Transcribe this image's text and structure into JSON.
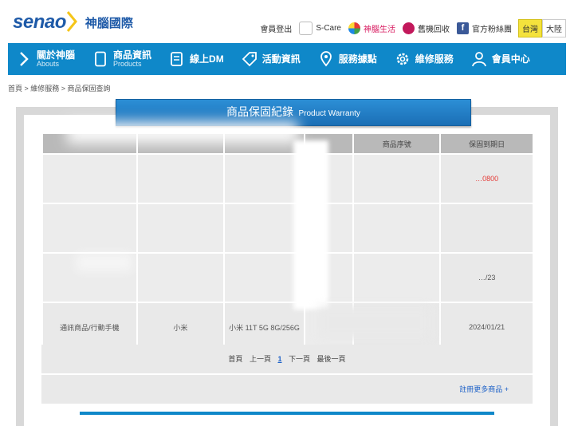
{
  "brand": {
    "word": "senao",
    "cn": "神腦國際"
  },
  "toplinks": {
    "logout": "會員登出",
    "scare": "S-Care",
    "life": "神腦生活",
    "recycle": "舊機回收",
    "fans": "官方粉絲團",
    "region_active": "台灣",
    "region_other": "大陸"
  },
  "nav": [
    {
      "label": "關於神腦",
      "sub": "Abouts"
    },
    {
      "label": "商品資訊",
      "sub": "Products"
    },
    {
      "label": "線上DM",
      "sub": ""
    },
    {
      "label": "活動資訊",
      "sub": ""
    },
    {
      "label": "服務據點",
      "sub": ""
    },
    {
      "label": "維修服務",
      "sub": ""
    },
    {
      "label": "會員中心",
      "sub": ""
    }
  ],
  "breadcrumb": "首頁 > 維修服務 > 商品保固查詢",
  "title": {
    "cn": "商品保固紀錄",
    "en": "Product Warranty"
  },
  "table": {
    "headers": [
      "",
      "",
      "",
      "",
      "商品序號",
      "保固到期日"
    ],
    "rows": [
      {
        "r2": "",
        "expiry": "…0800"
      },
      {
        "expiry": ""
      },
      {
        "expiry": "…/23"
      },
      {
        "category": "通訊商品/行動手機",
        "brand": "小米",
        "model": "小米 11T 5G 8G/256G",
        "serial": "",
        "expiry": "2024/01/21"
      }
    ]
  },
  "pager": {
    "first": "首頁",
    "prev": "上一頁",
    "current": "1",
    "next": "下一頁",
    "last": "最後一頁"
  },
  "register": "註冊更多商品 +",
  "colors": {
    "nav": "#0f88c9",
    "banner": "#1b6fb5",
    "region_active": "#f4e23c"
  }
}
